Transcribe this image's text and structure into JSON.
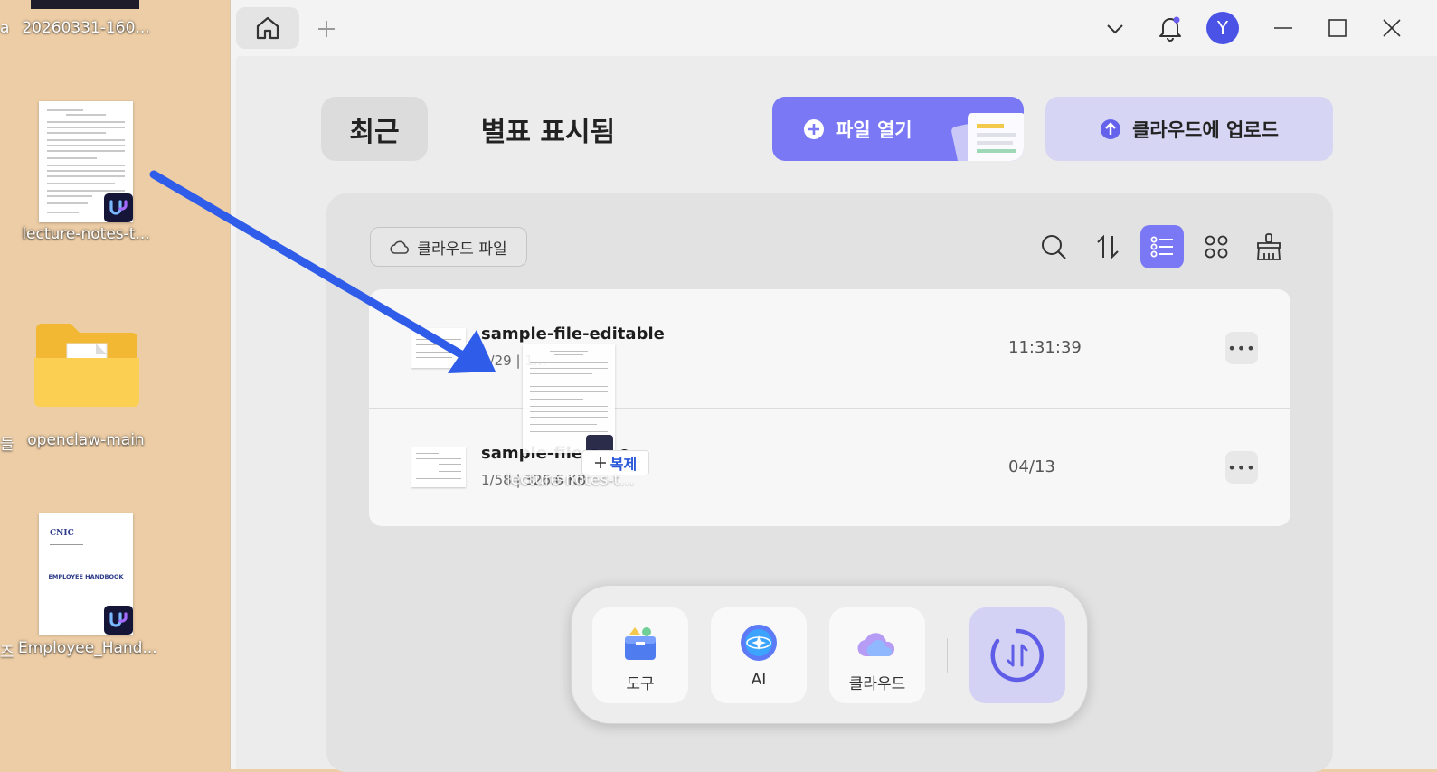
{
  "desktop": {
    "edge_labels": [
      "a",
      "20260331-160...",
      "들",
      "즈"
    ],
    "icons": [
      {
        "label": "lecture-notes-t..."
      },
      {
        "label": "openclaw-main"
      },
      {
        "label": "Employee_Hand..."
      }
    ],
    "handbook_cover": {
      "brand": "CNIC",
      "title": "EMPLOYEE HANDBOOK"
    }
  },
  "window": {
    "avatar_letter": "Y",
    "segments": {
      "recent": "최근",
      "starred": "별표 표시됨"
    },
    "open_file_label": "파일 열기",
    "upload_label": "클라우드에 업로드",
    "cloud_files_label": "클라우드 파일",
    "files": [
      {
        "name": "sample-file-editable",
        "meta": "1/29 | 1...",
        "time": "11:31:39"
      },
      {
        "name": "sample-file-e...o",
        "meta": "1/58 | 326.6 KB",
        "time": "04/13"
      }
    ],
    "dock": {
      "tools": "도구",
      "ai": "AI",
      "cloud": "클라우드"
    },
    "drag": {
      "copy_label": "복제",
      "file_label": "lecture-notes-t..."
    }
  },
  "colors": {
    "accent": "#7a78f4",
    "accent_soft": "#d6d5f3",
    "arrow": "#2f5ce8",
    "avatar": "#4a53e6"
  }
}
